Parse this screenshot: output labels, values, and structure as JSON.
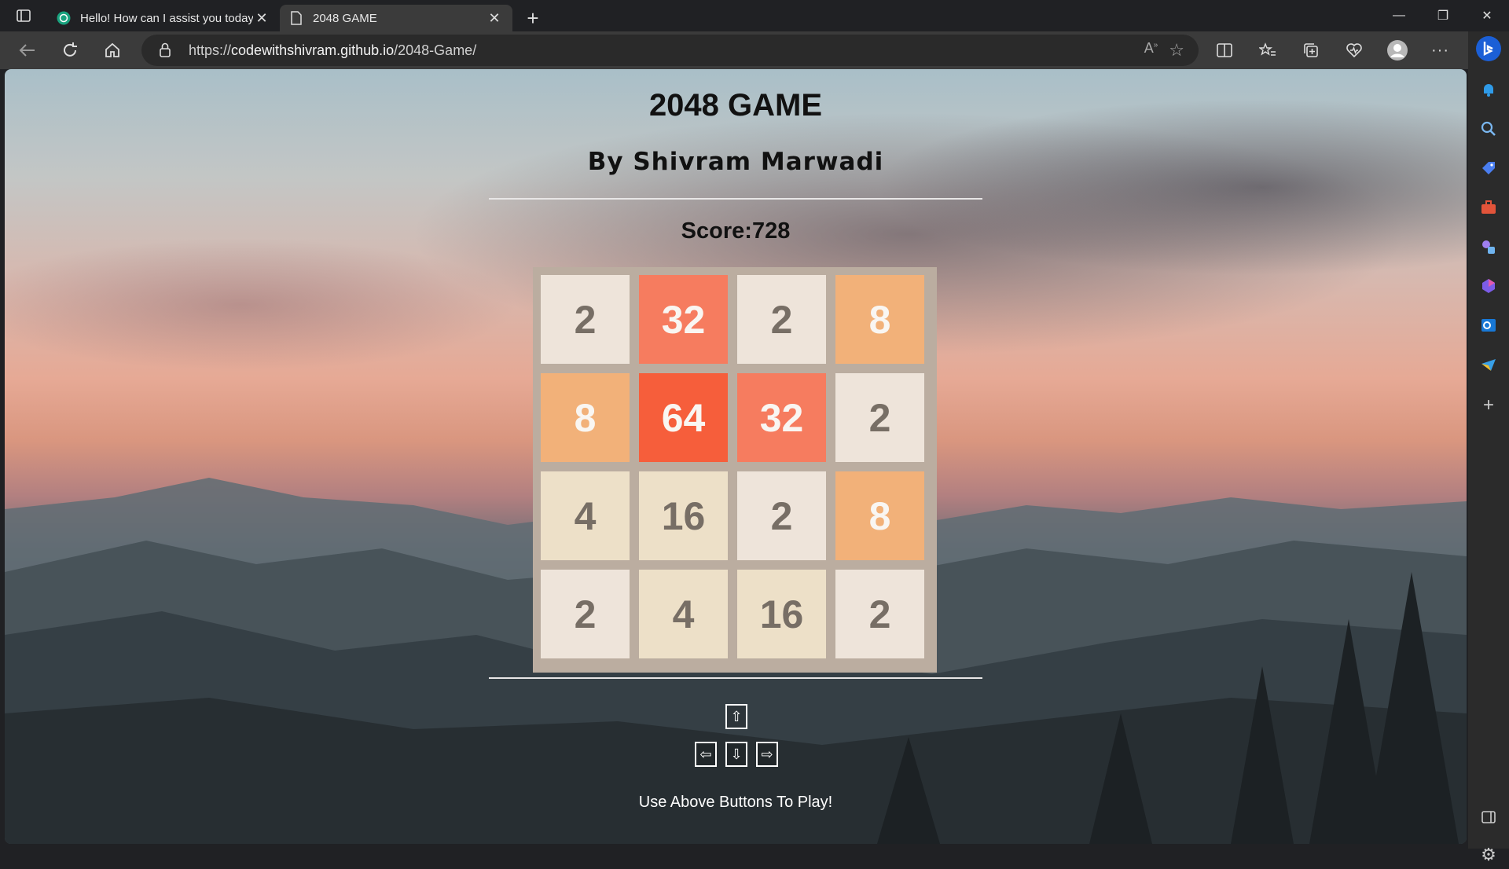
{
  "browser": {
    "tabs": [
      {
        "title": "Hello! How can I assist you today",
        "active": false,
        "icon": "chatgpt-icon"
      },
      {
        "title": "2048 GAME",
        "active": true,
        "icon": "page-icon"
      }
    ],
    "url_prefix": "https://",
    "url_host": "codewithshivram.github.io",
    "url_path": "/2048-Game/"
  },
  "page": {
    "title": "2048 GAME",
    "author": "By Shivram Marwadi",
    "score_label": "Score:",
    "score": "728",
    "hint": "Use Above Buttons To Play!",
    "controls": {
      "up": "⇧",
      "left": "⇦",
      "down": "⇩",
      "right": "⇨"
    }
  },
  "board": [
    [
      2,
      32,
      2,
      8
    ],
    [
      8,
      64,
      32,
      2
    ],
    [
      4,
      16,
      2,
      8
    ],
    [
      2,
      4,
      16,
      2
    ]
  ],
  "tile_colors": {
    "2": {
      "bg": "#eee4da",
      "fg": "#776e65"
    },
    "4": {
      "bg": "#ede0c8",
      "fg": "#776e65"
    },
    "8": {
      "bg": "#f2b179",
      "fg": "#f9f6f2"
    },
    "16": {
      "bg": "#ede0c8",
      "fg": "#776e65"
    },
    "32": {
      "bg": "#f67c5f",
      "fg": "#f9f6f2"
    },
    "64": {
      "bg": "#f65e3b",
      "fg": "#f9f6f2"
    }
  }
}
